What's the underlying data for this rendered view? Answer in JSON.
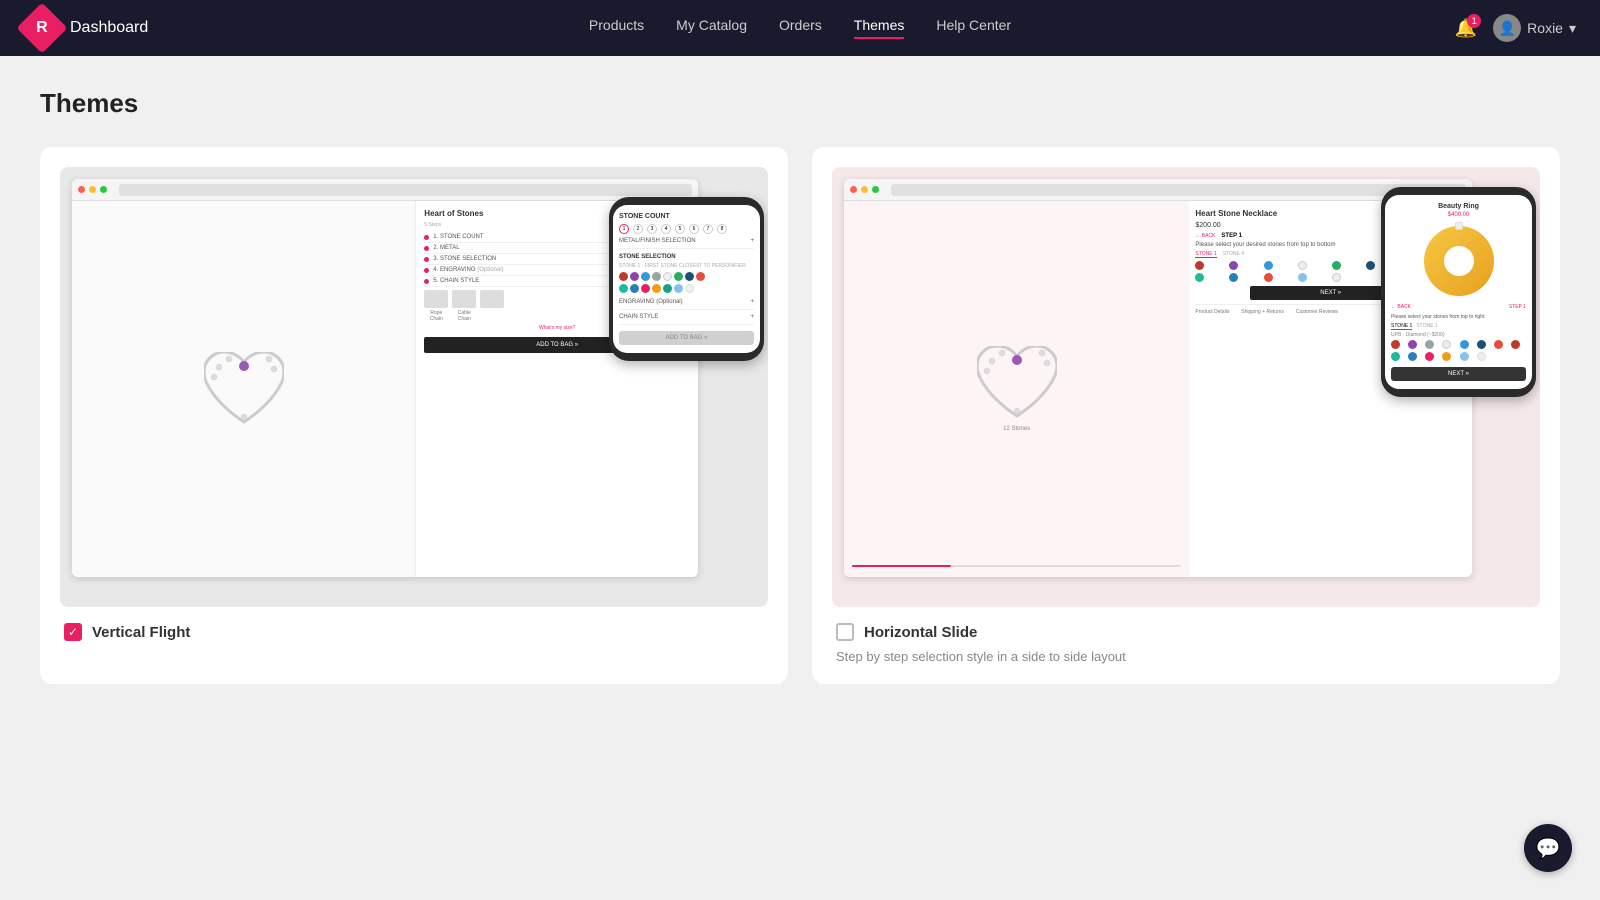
{
  "navbar": {
    "brand": "Dashboard",
    "logo_letter": "R",
    "nav_items": [
      "Products",
      "My Catalog",
      "Orders",
      "Themes",
      "Help Center"
    ],
    "active_nav": "Themes",
    "notification_count": "1",
    "user_name": "Roxie"
  },
  "page": {
    "title": "Themes"
  },
  "themes": [
    {
      "id": "vertical-flight",
      "label": "Vertical Flight",
      "description": "",
      "checked": true,
      "preview": {
        "product_name": "Heart of Stones",
        "steps": [
          "1. STONE COUNT",
          "2. METAL",
          "3. STONE SELECTION",
          "4. ENGRAVING",
          "5. CHAIN STYLE"
        ],
        "mobile_steps": [
          "STONE COUNT",
          "METAL/FINISH SELECTION",
          "STONE SELECTION",
          "ENGRAVING (Optional)",
          "CHAIN STYLE"
        ],
        "add_to_bag": "ADD TO BAG »",
        "chain_types": [
          "Rope Chain",
          "Cable Chain"
        ]
      }
    },
    {
      "id": "horizontal-slide",
      "label": "Horizontal Slide",
      "description": "Step by step selection style in a side to side layout",
      "checked": false,
      "preview": {
        "product_name": "Heart Stone Necklace",
        "price": "$200.00",
        "step_label": "STEP 1",
        "next_btn": "NEXT »",
        "mobile_product": "Beauty Ring",
        "mobile_price": "$400.00",
        "mobile_step": "STEP 1",
        "mobile_next": "NEXT »",
        "tab_labels": [
          "Product Details",
          "Shipping + Returns",
          "Customer Reviews"
        ]
      }
    }
  ],
  "colors": {
    "primary": "#e91e63",
    "dark": "#1a1a2e",
    "text": "#333",
    "light_bg": "#f0f0f0"
  },
  "stone_colors": [
    "#c0392b",
    "#8e44ad",
    "#3498db",
    "#95a5a6",
    "#27ae60",
    "#1a5276",
    "#e74c3c",
    "#6c3483",
    "#2ecc71",
    "#2980b9",
    "#f39c12",
    "#16a085",
    "#1abc9c",
    "#e67e22",
    "#85c1e9",
    "#a9cce3",
    "#f1948a",
    "#bb8fce",
    "#a3e4d7",
    "#f8c471"
  ],
  "chat": {
    "icon": "💬"
  }
}
